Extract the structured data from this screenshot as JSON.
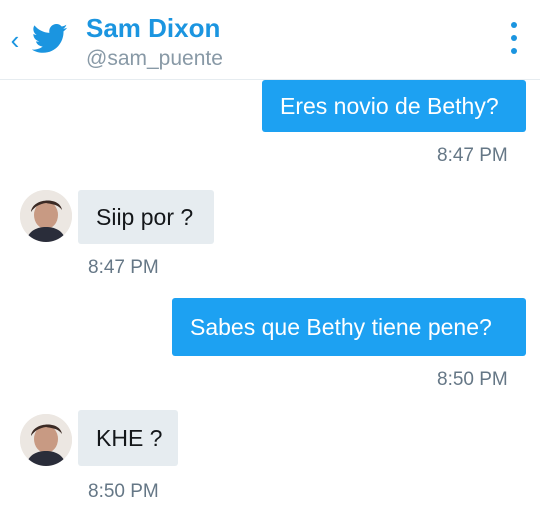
{
  "header": {
    "back_icon": "chevron-left-icon",
    "brand_icon": "twitter-bird-icon",
    "name": "Sam Dixon",
    "handle": "@sam_puente",
    "more_icon": "vertical-dots-icon",
    "accent_color": "#1b95e0"
  },
  "messages": [
    {
      "direction": "outgoing",
      "text": "Eres novio de Bethy?",
      "time": "8:47 PM"
    },
    {
      "direction": "incoming",
      "text": "Siip por ?",
      "time": "8:47 PM"
    },
    {
      "direction": "outgoing",
      "text": "Sabes que Bethy tiene pene?",
      "time": "8:50 PM"
    },
    {
      "direction": "incoming",
      "text": "KHE ?",
      "time": "8:50 PM"
    }
  ],
  "colors": {
    "outgoing_bubble": "#1da1f2",
    "incoming_bubble": "#e6ecf0",
    "timestamp": "#657786"
  }
}
